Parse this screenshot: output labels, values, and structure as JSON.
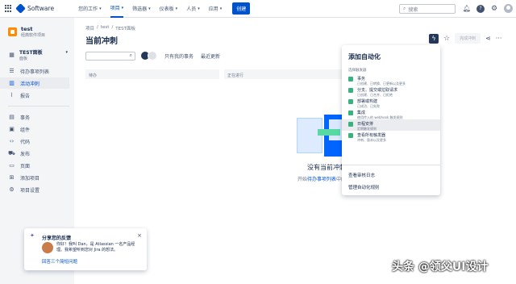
{
  "app": {
    "name": "Software"
  },
  "nav": {
    "items": [
      "您的工作",
      "项目",
      "筛选器",
      "仪表板",
      "人员",
      "应用"
    ],
    "active_index": 1,
    "create_label": "创建"
  },
  "search": {
    "placeholder": "搜索"
  },
  "sidebar": {
    "project_name": "test",
    "project_type": "经典软件项目",
    "board_name": "TEST面板",
    "board_type": "面板",
    "items": [
      "待办事项列表",
      "活动冲刺",
      "报告"
    ],
    "active_index": 1,
    "items2": [
      "事务",
      "组件",
      "代码",
      "发布",
      "页面",
      "添加项目",
      "项目设置"
    ]
  },
  "main": {
    "breadcrumb": [
      "项目",
      "test",
      "TEST面板"
    ],
    "title": "当前冲刺",
    "complete_label": "完成冲刺",
    "filters": [
      "只有我的事务",
      "最近更新"
    ],
    "columns": [
      "待办",
      "正在进行"
    ],
    "empty_title": "没有当前冲刺",
    "empty_sub_prefix": "开始",
    "empty_sub_link": "待办事项列表",
    "empty_sub_suffix": "中的冲刺"
  },
  "automation": {
    "title": "添加自动化",
    "section": "选择触发器",
    "items": [
      {
        "title": "事务",
        "desc": "已创建、已转换、已更新以及更多",
        "color": "#36b37e"
      },
      {
        "title": "分支、提交或拉取请求",
        "desc": "已创建、已合并、已拒绝",
        "color": "#36b37e"
      },
      {
        "title": "部署或构建",
        "desc": "已成功、已失败",
        "color": "#36b37e"
      },
      {
        "title": "集成",
        "desc": "使用传入的 webhook 触发规则",
        "color": "#36b37e"
      },
      {
        "title": "日程安排",
        "desc": "定期触发规则",
        "color": "#36b37e"
      },
      {
        "title": "查看所有触发器",
        "desc": "冲刺、版本以及更多",
        "color": "#36b37e"
      }
    ],
    "highlight_index": 4,
    "link_audit": "查看审核日志",
    "link_manage": "管理自动化规则"
  },
  "feedback": {
    "title": "分享您的反馈",
    "text": "你好！我叫 Dan，是 Atlassian 一名产品经理。我希望听到您对 Jira 的想法。",
    "link": "回答三个简短问题"
  },
  "watermark": "头条 @领父UI设计"
}
